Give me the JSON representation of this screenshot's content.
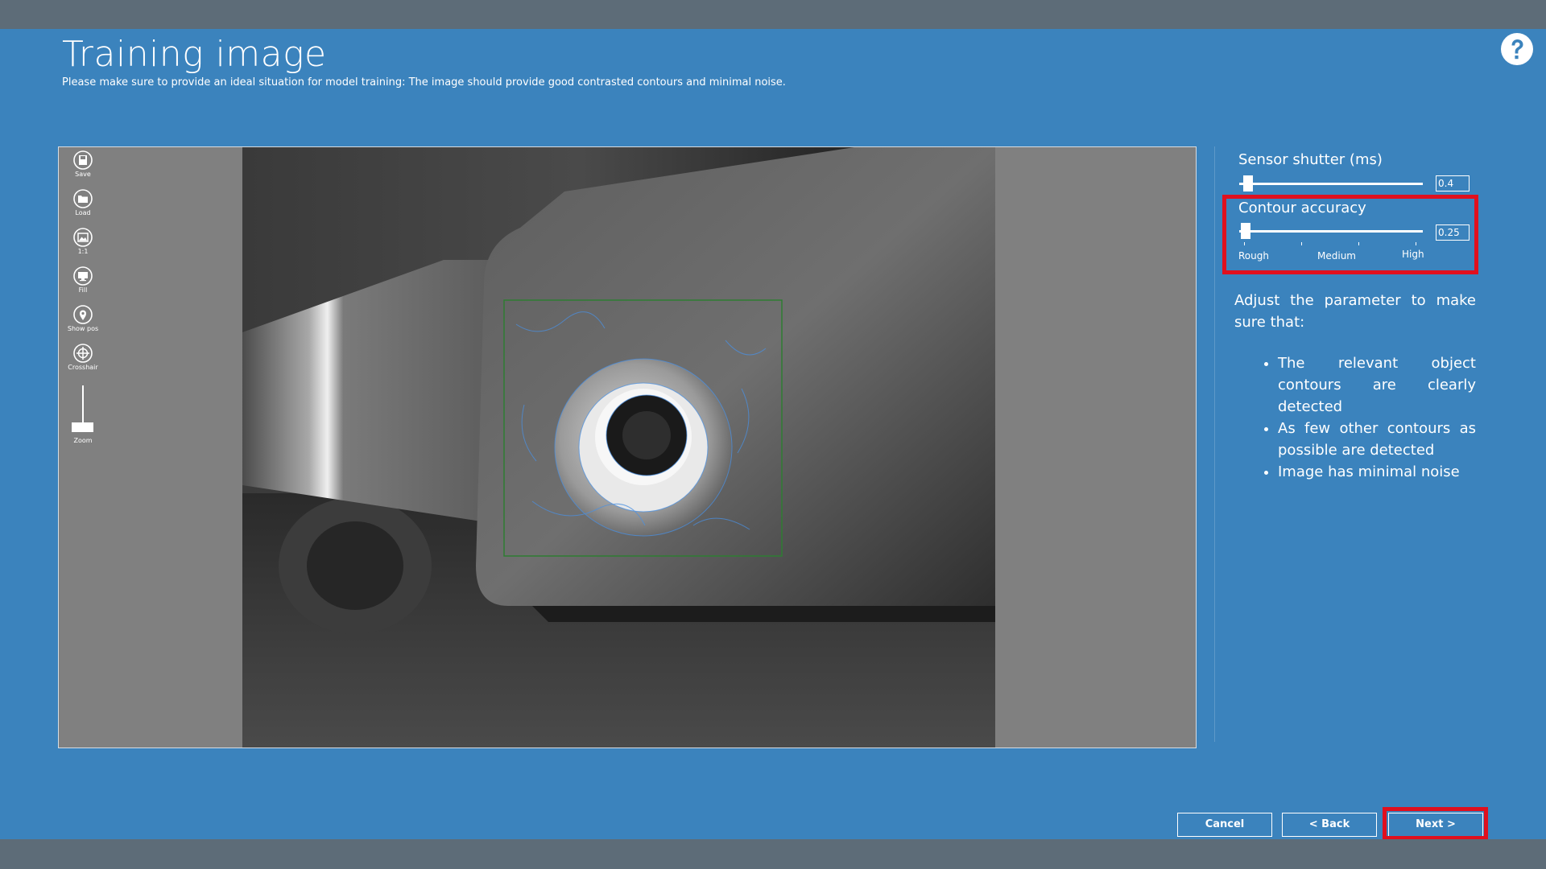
{
  "page": {
    "title": "Training image",
    "subtitle": "Please make sure to provide an ideal situation for model training: The image should provide good contrasted contours and minimal noise.",
    "help_icon": "help-question-icon"
  },
  "toolbar": {
    "items": [
      {
        "label": "Save",
        "icon": "save-icon"
      },
      {
        "label": "Load",
        "icon": "folder-icon"
      },
      {
        "label": "1:1",
        "icon": "image-icon"
      },
      {
        "label": "Fill",
        "icon": "monitor-icon"
      },
      {
        "label": "Show pos",
        "icon": "map-pin-icon"
      },
      {
        "label": "Crosshair",
        "icon": "crosshair-icon"
      }
    ],
    "zoom_label": "Zoom"
  },
  "params": {
    "sensor_shutter": {
      "label": "Sensor shutter (ms)",
      "value": "0.4"
    },
    "contour_accuracy": {
      "label": "Contour accuracy",
      "value": "0.25",
      "ticks": [
        "Rough",
        "Medium",
        "High"
      ]
    }
  },
  "instructions": {
    "intro": "Adjust the parameter to make sure that:",
    "bullets": [
      "The relevant object contours are clearly detected",
      "As few other contours as possible are detected",
      "Image has minimal noise"
    ]
  },
  "buttons": {
    "cancel": "Cancel",
    "back": "< Back",
    "next": "Next >"
  },
  "colors": {
    "background": "#3b83bd",
    "bar": "#5d6c78",
    "highlight": "#e0101e",
    "roi": "#2e7d32",
    "contour": "#4a90e2"
  }
}
